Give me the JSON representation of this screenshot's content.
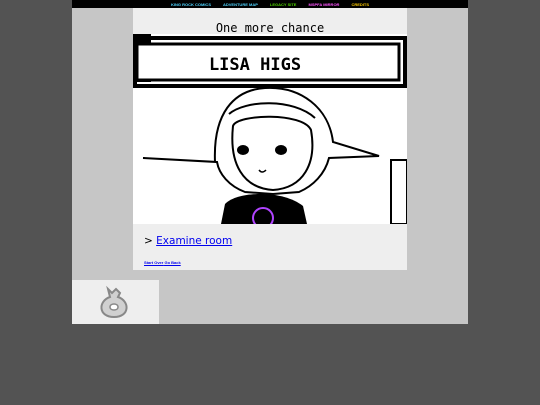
{
  "nav": {
    "items": [
      {
        "label": "KING ROCK COMICS",
        "color": "#4fd4ff"
      },
      {
        "label": "ADVENTURE MAP",
        "color": "#4fd4ff"
      },
      {
        "label": "LEGACY SITE",
        "color": "#4fd400"
      },
      {
        "label": "MSPFA MIRROR",
        "color": "#ff55ff"
      },
      {
        "label": "CREDITS",
        "color": "#ffcc00"
      }
    ]
  },
  "page": {
    "title": "One more chance",
    "art_caption": "LISA HIGS",
    "next_prefix": ">",
    "next_link": "Examine room",
    "start_over": "Start Over",
    "go_back": "Go Back"
  },
  "footer": {
    "icon": "moneybag-icon"
  },
  "colors": {
    "background": "#535353",
    "frame": "#c6c6c6",
    "panel": "#eeeeee",
    "link": "#0000ee"
  }
}
